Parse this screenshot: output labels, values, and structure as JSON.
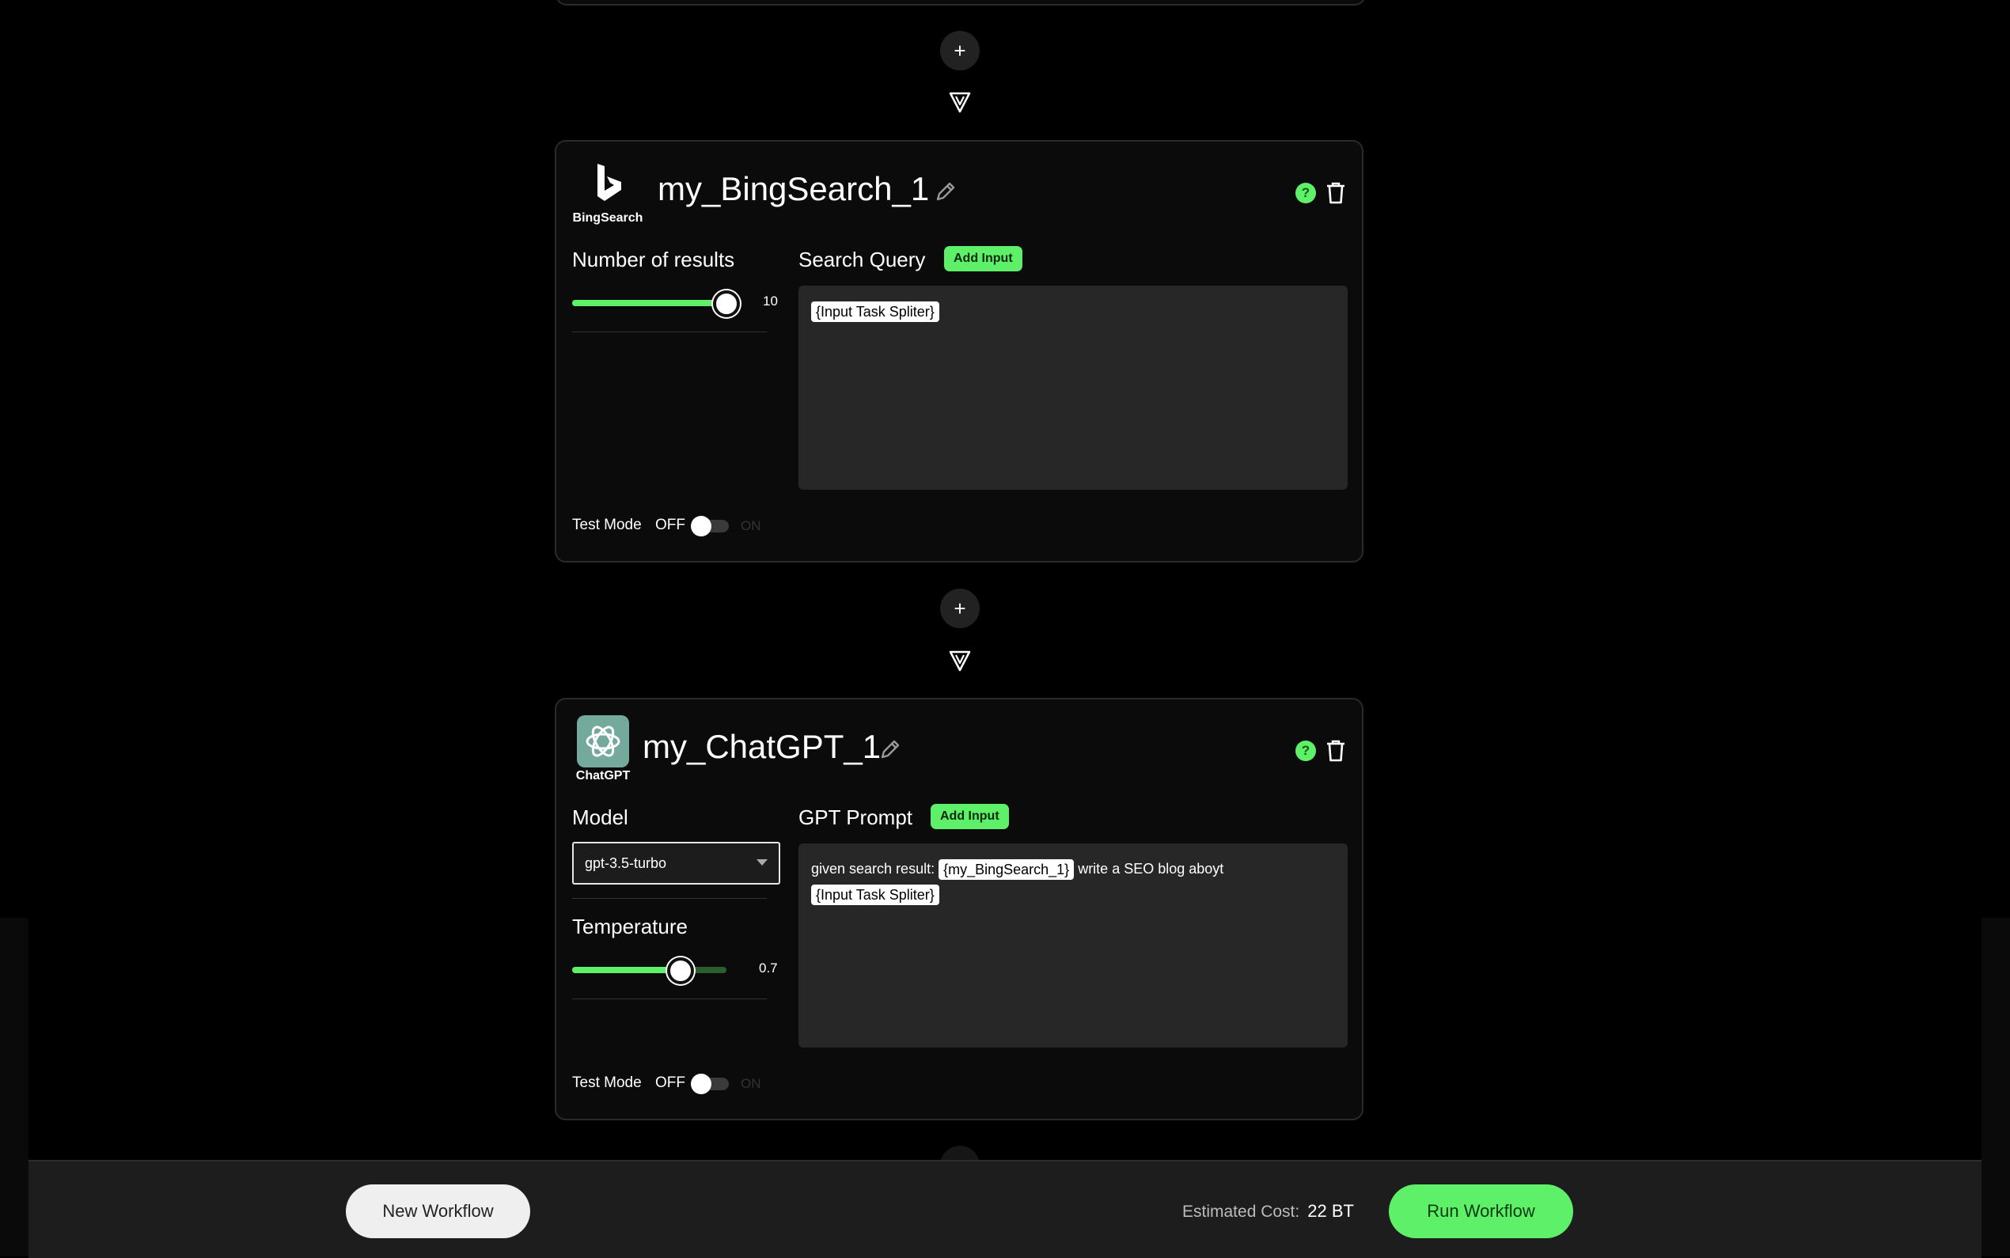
{
  "colors": {
    "accent": "#5ff06a",
    "background": "#000000",
    "card": "#0b0b0b",
    "textarea": "#272727"
  },
  "connector": {
    "plus_label": "+"
  },
  "bing_card": {
    "title": "my_BingSearch_1",
    "logo_label": "BingSearch",
    "help_label": "?",
    "results_label": "Number of results",
    "results_value": "10",
    "results_fraction": 1.0,
    "query_label": "Search Query",
    "add_input_label": "Add Input",
    "query_chip": "{Input Task Spliter}",
    "test_mode_label": "Test Mode",
    "test_mode_off": "OFF",
    "test_mode_on": "ON"
  },
  "chatgpt_card": {
    "title": "my_ChatGPT_1",
    "logo_label": "ChatGPT",
    "help_label": "?",
    "model_label": "Model",
    "model_value": "gpt-3.5-turbo",
    "temperature_label": "Temperature",
    "temperature_value": "0.7",
    "temperature_fraction": 0.7,
    "prompt_label": "GPT Prompt",
    "add_input_label": "Add Input",
    "prompt_text_1": "given search result: ",
    "prompt_chip_1": "{my_BingSearch_1}",
    "prompt_text_2": " write a SEO blog aboyt",
    "prompt_chip_2": "{Input Task Spliter}",
    "test_mode_label": "Test Mode",
    "test_mode_off": "OFF",
    "test_mode_on": "ON"
  },
  "footer": {
    "new_workflow_label": "New Workflow",
    "cost_label": "Estimated Cost:",
    "cost_value": "22 BT",
    "run_workflow_label": "Run Workflow"
  }
}
